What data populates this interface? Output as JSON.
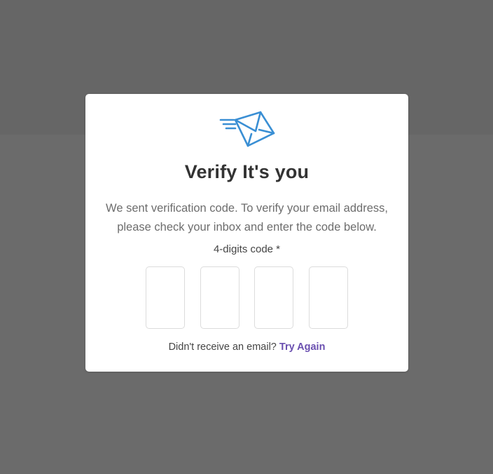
{
  "dialog": {
    "icon": "email-sent-icon",
    "title": "Verify It's you",
    "description_line1": "We sent verification code. To verify your email address,",
    "description_line2": "please check your inbox and enter the code below.",
    "code_label": "4-digits code *",
    "code_digits": [
      "",
      "",
      "",
      ""
    ],
    "resend_text": "Didn't receive an email?",
    "resend_link": "Try Again"
  },
  "colors": {
    "overlay": "#6b6b6b",
    "icon_blue": "#3a8fd4",
    "link_purple": "#6a4fb0",
    "title": "#333333"
  }
}
